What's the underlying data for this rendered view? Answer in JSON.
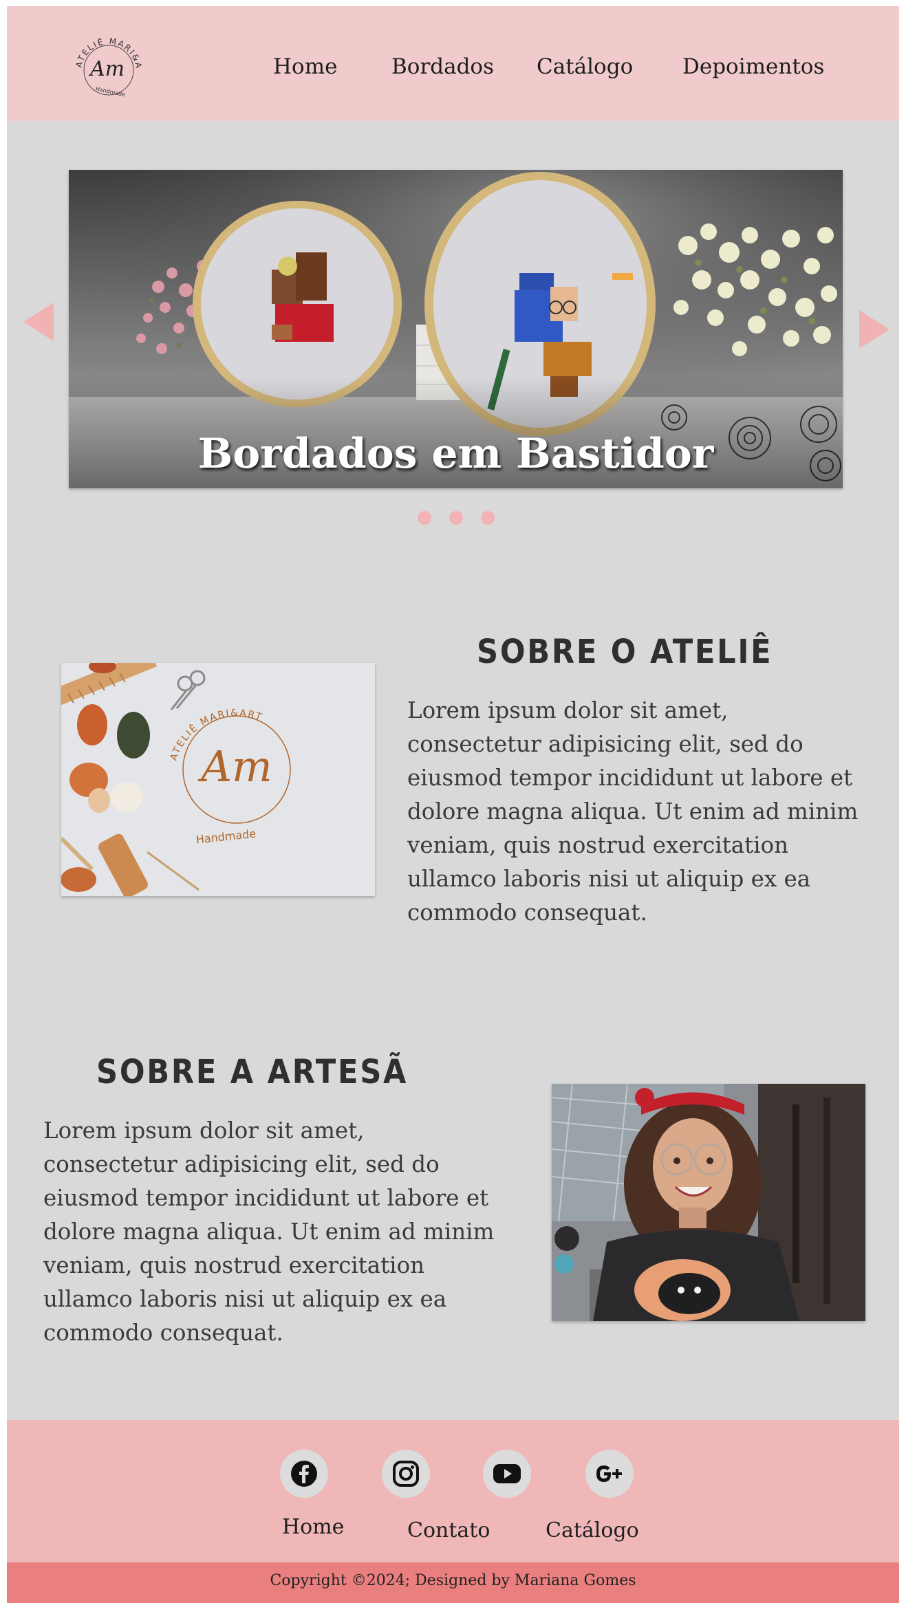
{
  "header": {
    "logo": {
      "ring_text": "ATELIÊ MARI&ART",
      "monogram": "Am",
      "tagline": "Handmade"
    },
    "nav": [
      "Home",
      "Bordados",
      "Catálogo",
      "Depoimentos"
    ]
  },
  "carousel": {
    "caption": "Bordados em Bastidor",
    "slide_count": 3,
    "active_index": 0,
    "prev_icon": "triangle-left-icon",
    "next_icon": "triangle-right-icon"
  },
  "about_atelier": {
    "title": "SOBRE O ATELIÊ",
    "text": "Lorem ipsum dolor sit amet, consectetur adipisicing elit, sed do eiusmod tempor incididunt ut labore et dolore magna aliqua. Ut enim ad minim veniam, quis nostrud exercitation ullamco laboris nisi ut aliquip ex ea commodo consequat.",
    "image": {
      "ring_text": "ATELIÊ MARI&ART",
      "monogram": "Am",
      "tagline": "Handmade"
    }
  },
  "about_artisan": {
    "title": "SOBRE A ARTESÃ",
    "text": "Lorem ipsum dolor sit amet, consectetur adipisicing elit, sed do eiusmod tempor incididunt ut labore et dolore magna aliqua. Ut enim ad minim veniam, quis nostrud exercitation ullamco laboris nisi ut aliquip ex ea commodo consequat."
  },
  "footer": {
    "social_icons": [
      "facebook-icon",
      "instagram-icon",
      "youtube-icon",
      "google-plus-icon"
    ],
    "links": [
      "Home",
      "Contato",
      "Catálogo"
    ],
    "copyright": "Copyright ©2024; Designed by Mariana Gomes"
  },
  "colors": {
    "header_bg": "#f1cbcb",
    "page_bg": "#d9d9d9",
    "footer_bg": "#efb7b8",
    "copyright_bg": "#ea7f7f",
    "accent_pink": "#f3b3b5",
    "logo_brown": "#b0652a"
  }
}
